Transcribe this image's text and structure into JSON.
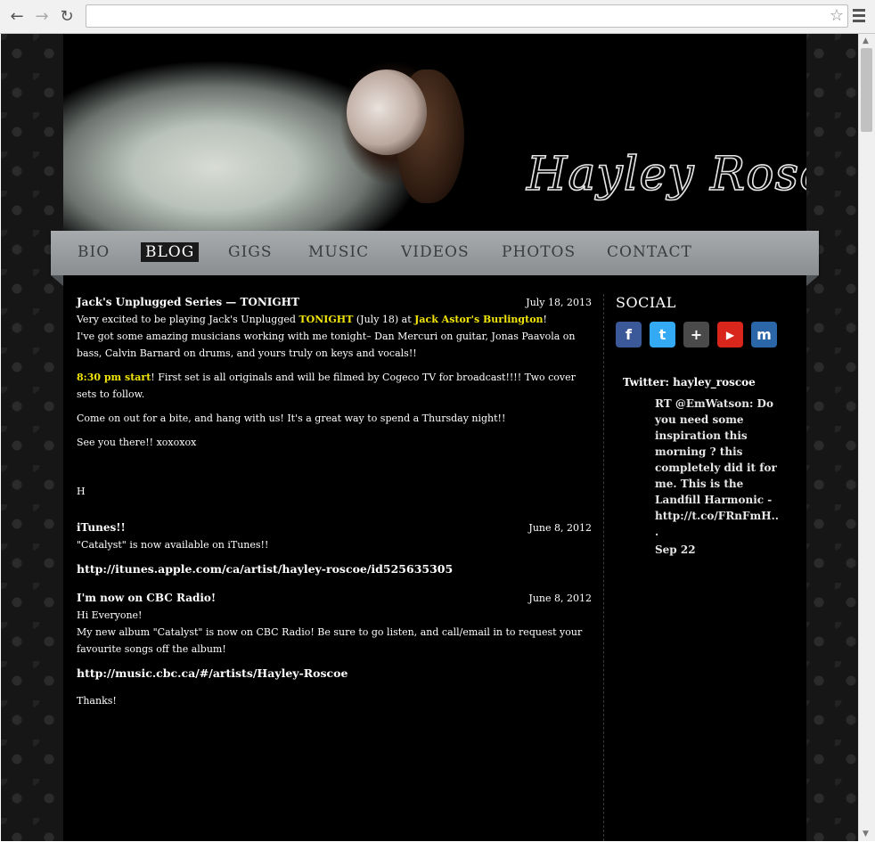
{
  "browser": {
    "back_icon": "arrow-left-icon",
    "forward_icon": "arrow-right-icon",
    "reload_icon": "reload-icon",
    "url": "",
    "bookmark_icon": "star-icon",
    "menu_icon": "hamburger-menu-icon"
  },
  "site": {
    "logo_text": "Hayley Roscoe"
  },
  "nav": {
    "items": [
      {
        "label": "BIO"
      },
      {
        "label": "BLOG"
      },
      {
        "label": "GIGS"
      },
      {
        "label": "MUSIC"
      },
      {
        "label": "VIDEOS"
      },
      {
        "label": "PHOTOS"
      },
      {
        "label": "CONTACT"
      }
    ],
    "active": "BLOG"
  },
  "posts": [
    {
      "title": "Jack's Unplugged Series — TONIGHT",
      "date": "July 18, 2013",
      "line1_a": "Very excited to be playing Jack's Unplugged ",
      "line1_b": "TONIGHT",
      "line1_c": " (July 18) at ",
      "line1_d": "Jack Astor's Burlington",
      "line1_e": "!",
      "line2": "I've got some amazing musicians working with me tonight– Dan Mercuri on guitar, Jonas Paavola on bass, Calvin Barnard on drums, and yours truly on keys and vocals!!",
      "p2_a": "8:30 pm start",
      "p2_b": "! First set is all originals and will be filmed by Cogeco TV for broadcast!!!! Two cover sets to follow.",
      "p3": "Come on out for a bite, and hang with us! It's a great way to spend a Thursday night!!",
      "p4": "See you there!! xoxoxox",
      "p5": "H"
    },
    {
      "title": "iTunes!!",
      "date": "June 8, 2012",
      "p1": "\"Catalyst\" is now available on iTunes!!",
      "link": "http://itunes.apple.com/ca/artist/hayley-roscoe/id525635305"
    },
    {
      "title": "I'm now on CBC Radio!",
      "date": "June 8, 2012",
      "p1": "Hi Everyone!",
      "p2": "My new album \"Catalyst\" is now on CBC Radio! Be sure to go listen, and call/email in to request your favourite songs off the album!",
      "link": "http://music.cbc.ca/#/artists/Hayley-Roscoe",
      "p3": "Thanks!"
    }
  ],
  "sidebar": {
    "social_title": "SOCIAL",
    "icons": [
      {
        "name": "facebook-icon",
        "glyph": "f",
        "color": "#3b5998"
      },
      {
        "name": "twitter-icon",
        "glyph": "t",
        "color": "#33aaf3"
      },
      {
        "name": "google-plus-icon",
        "glyph": "+",
        "color": "#4a4a4a"
      },
      {
        "name": "youtube-icon",
        "glyph": "▶",
        "color": "#d8261c"
      },
      {
        "name": "myspace-icon",
        "glyph": "m",
        "color": "#2a66a8"
      }
    ],
    "twitter_title": "Twitter: hayley_roscoe",
    "tweet_text": "RT @EmWatson: Do you need some inspiration this morning ? this completely did it for me. This is the Landfill Harmonic - http://t.co/FRnFmH...",
    "tweet_date": "Sep 22"
  },
  "colors": {
    "highlight": "#f2e50a",
    "nav_bg": "#9b9fa2",
    "page_bg": "#000000"
  }
}
